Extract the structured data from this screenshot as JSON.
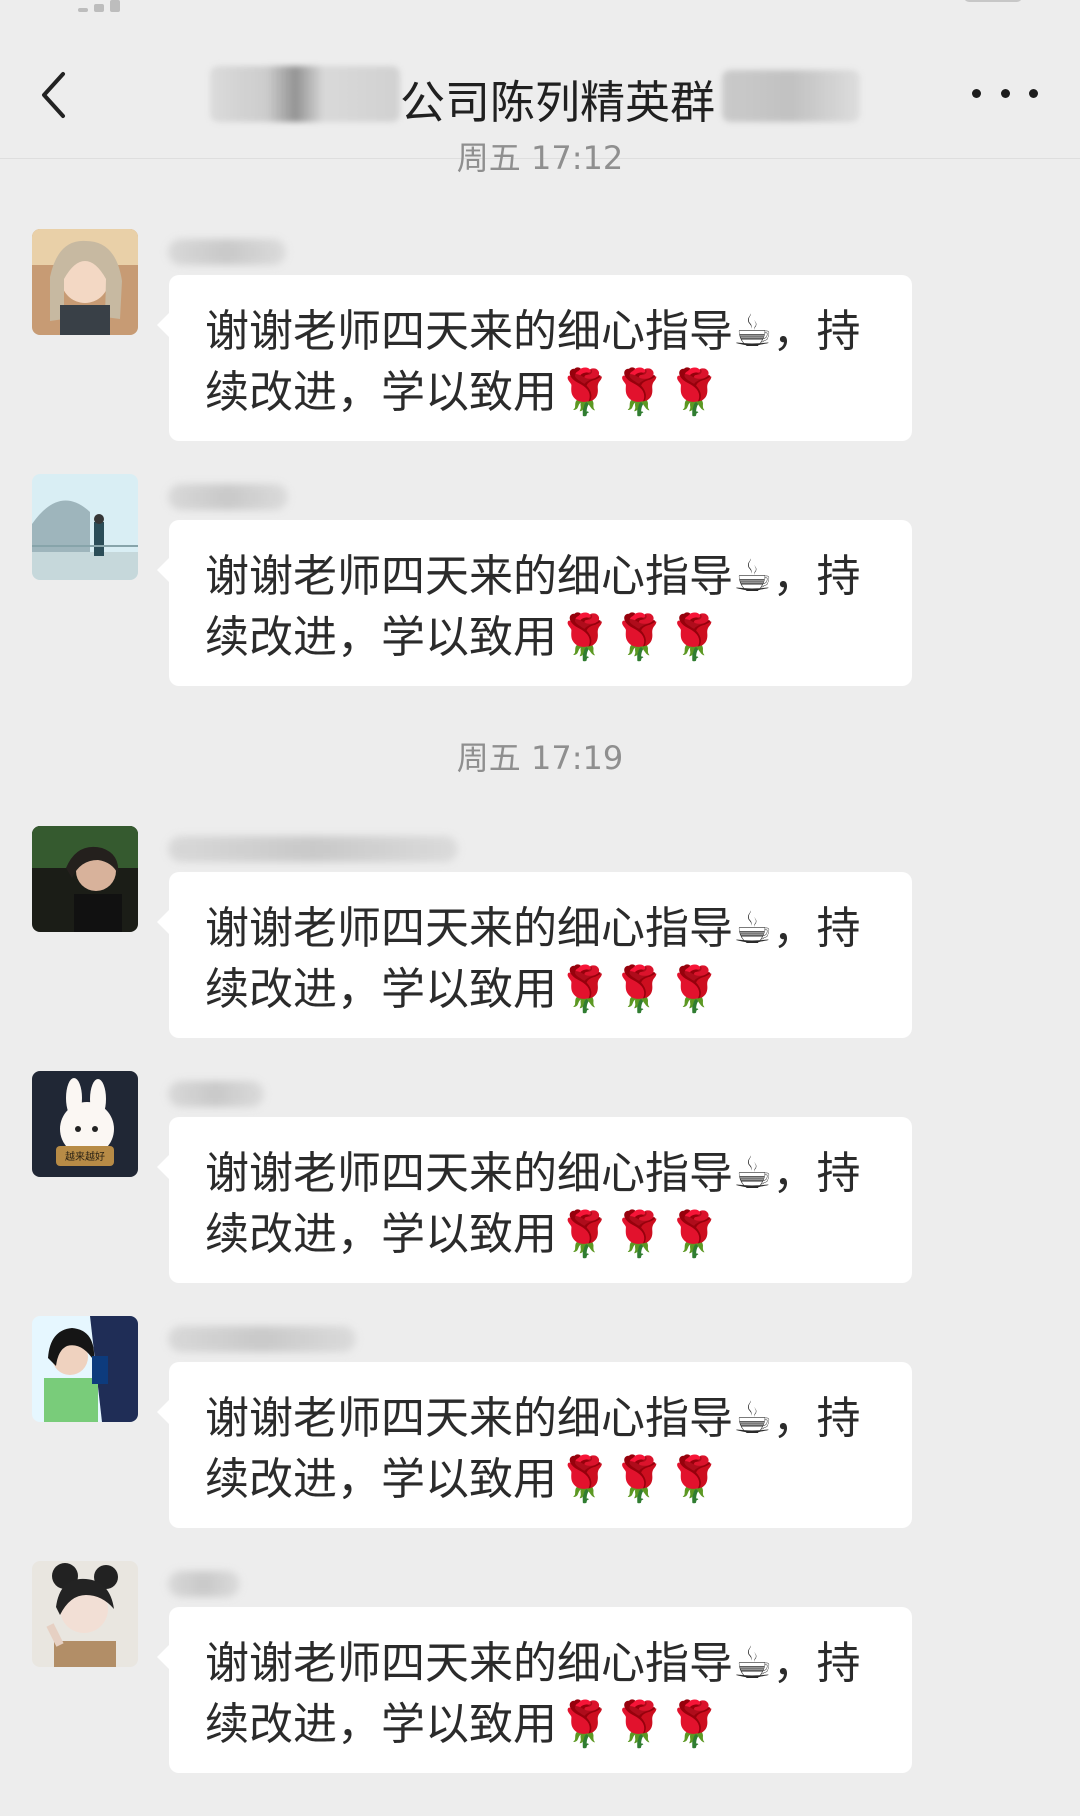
{
  "header": {
    "title": "公司陈列精英群"
  },
  "timestamps": {
    "top": "周五 17:12",
    "middle": "周五 17:19"
  },
  "messages": [
    {
      "text": "谢谢老师四天来的细心指导☕，持续改进，学以致用🌹🌹🌹"
    },
    {
      "text": "谢谢老师四天来的细心指导☕，持续改进，学以致用🌹🌹🌹"
    },
    {
      "text": "谢谢老师四天来的细心指导☕，持续改进，学以致用🌹🌹🌹"
    },
    {
      "text": "谢谢老师四天来的细心指导☕，持续改进，学以致用🌹🌹🌹"
    },
    {
      "text": "谢谢老师四天来的细心指导☕，持续改进，学以致用🌹🌹🌹"
    },
    {
      "text": "谢谢老师四天来的细心指导☕，持续改进，学以致用🌹🌹🌹"
    }
  ],
  "icons": {
    "back": "chevron-left-icon",
    "more": "more-icon"
  },
  "colors": {
    "background": "#ededed",
    "bubble": "#ffffff",
    "text": "#2b2b2b",
    "timestamp": "#8f8f8f"
  }
}
